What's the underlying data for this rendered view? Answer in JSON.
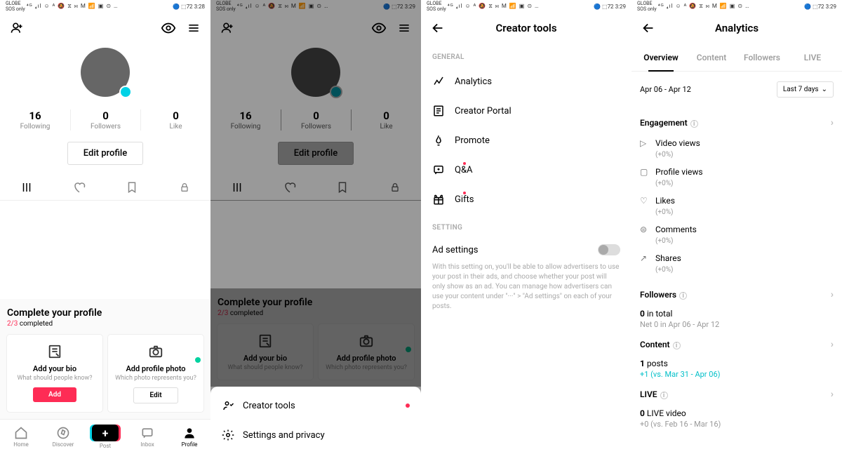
{
  "status": {
    "carrier": "GLOBE",
    "sos": "SOS only",
    "icons": "⁴ᴳ ₄ıl ☺ ᴬ 🔕 ⧖ ⋈ M 📶 ▣ ⊙ …",
    "bt": "🔵",
    "batt": "72",
    "time1": "3:28",
    "time2": "3:29"
  },
  "profile": {
    "stats": [
      {
        "num": "16",
        "label": "Following"
      },
      {
        "num": "0",
        "label": "Followers"
      },
      {
        "num": "0",
        "label": "Like"
      }
    ],
    "edit": "Edit profile"
  },
  "complete": {
    "title": "Complete your profile",
    "done": "2/",
    "total": "3",
    "completed": " completed",
    "cards": [
      {
        "title": "Add your bio",
        "sub": "What should people know?",
        "btn": "Add"
      },
      {
        "title": "Add profile photo",
        "sub": "Which photo represents you?",
        "btn": "Edit"
      }
    ]
  },
  "nav": [
    "Home",
    "Discover",
    "Post",
    "Inbox",
    "Profile"
  ],
  "sheet": {
    "creator": "Creator tools",
    "settings": "Settings and privacy"
  },
  "creator": {
    "title": "Creator tools",
    "general": "GENERAL",
    "items": [
      "Analytics",
      "Creator Portal",
      "Promote",
      "Q&A",
      "Gifts"
    ],
    "setting": "SETTING",
    "ad_title": "Ad settings",
    "ad_desc": "With this setting on, you'll be able to allow advertisers to use your post in their ads, and choose whether your post will only show as an ad. You can manage how advertisers can use your content under \"···\" > \"Ad settings\" on each of your posts."
  },
  "analytics": {
    "title": "Analytics",
    "tabs": [
      "Overview",
      "Content",
      "Followers",
      "LIVE"
    ],
    "daterange": "Apr 06 - Apr 12",
    "last7": "Last 7 days",
    "engagement": "Engagement",
    "metrics": [
      {
        "label": "Video views",
        "delta": "(+0%)"
      },
      {
        "label": "Profile views",
        "delta": "(+0%)"
      },
      {
        "label": "Likes",
        "delta": "(+0%)"
      },
      {
        "label": "Comments",
        "delta": "(+0%)"
      },
      {
        "label": "Shares",
        "delta": "(+0%)"
      }
    ],
    "followers": "Followers",
    "f_total_b": "0",
    "f_total": " in total",
    "f_net": "Net 0 in Apr 06 - Apr 12",
    "content": "Content",
    "c_b": "1",
    "c_posts": " posts",
    "c_plus": "+1 (vs. Mar 31 - Apr 06)",
    "live": "LIVE",
    "l_b": "0",
    "l_video": " LIVE video",
    "l_sub": "+0 (vs. Feb 16 - Mar 16)"
  }
}
